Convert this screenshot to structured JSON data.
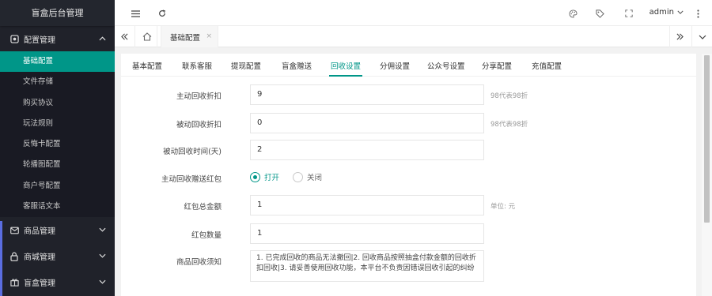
{
  "app": {
    "title": "盲盒后台管理"
  },
  "sidebar": {
    "group_config": "配置管理",
    "items": [
      {
        "label": "基础配置",
        "active": true
      },
      {
        "label": "文件存储"
      },
      {
        "label": "购买协议"
      },
      {
        "label": "玩法规则"
      },
      {
        "label": "反悔卡配置"
      },
      {
        "label": "轮播图配置"
      },
      {
        "label": "商户号配置"
      },
      {
        "label": "客服话文本"
      }
    ],
    "group_goods": "商品管理",
    "group_mall": "商城管理",
    "group_box": "盲盒管理"
  },
  "header": {
    "user": "admin"
  },
  "tabbar": {
    "active_tab": "基础配置",
    "close": "×"
  },
  "subtabs": [
    "基本配置",
    "联系客服",
    "提现配置",
    "盲盒赠送",
    "回收设置",
    "分佣设置",
    "公众号设置",
    "分享配置",
    "充值配置"
  ],
  "subtab_active_index": 4,
  "form": {
    "active_discount": {
      "label": "主动回收折扣",
      "value": "9",
      "hint": "98代表98折"
    },
    "passive_discount": {
      "label": "被动回收折扣",
      "value": "0",
      "hint": "98代表98折"
    },
    "passive_time": {
      "label": "被动回收时间(天)",
      "value": "2"
    },
    "send_redpacket": {
      "label": "主动回收赠送红包",
      "on": "打开",
      "off": "关闭"
    },
    "redpacket_total": {
      "label": "红包总金额",
      "value": "1",
      "hint": "单位: 元"
    },
    "redpacket_count": {
      "label": "红包数量",
      "value": "1"
    },
    "recycle_notice": {
      "label": "商品回收须知",
      "value": "1. 已完成回收的商品无法撤回|2. 回收商品按照抽盒付款金额的回收折扣回收|3. 请妥善使用回收功能，本平台不负责因错误回收引起的纠纷"
    }
  },
  "colors": {
    "accent": "#009688",
    "sidebar_bg": "#20222a"
  }
}
